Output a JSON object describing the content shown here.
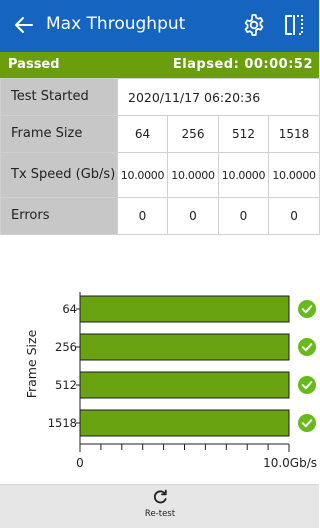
{
  "header": {
    "title": "Max Throughput",
    "back_icon": "arrow-left-icon",
    "settings_icon": "gear-icon",
    "panel_icon": "split-panel-icon",
    "bg_color": "#1565c0"
  },
  "status": {
    "result": "Passed",
    "elapsed": "Elapsed: 00:00:52",
    "bg_color": "#6a9e0c"
  },
  "table": {
    "test_started_label": "Test Started",
    "test_started_value": "2020/11/17 06:20:36",
    "frame_size_label": "Frame Size",
    "frame_sizes": [
      "64",
      "256",
      "512",
      "1518"
    ],
    "tx_speed_label": "Tx Speed (Gb/s)",
    "tx_speeds": [
      "10.0000",
      "10.0000",
      "10.0000",
      "10.0000"
    ],
    "errors_label": "Errors",
    "errors": [
      "0",
      "0",
      "0",
      "0"
    ]
  },
  "chart_data": {
    "type": "bar",
    "orientation": "horizontal",
    "categories": [
      "64",
      "256",
      "512",
      "1518"
    ],
    "values": [
      10.0,
      10.0,
      10.0,
      10.0
    ],
    "xlim": [
      0,
      10.0
    ],
    "xtick_labels": [
      "0",
      "10.0Gb/s"
    ],
    "ylabel": "Frame Size",
    "bar_color": "#6aa312",
    "status_icon": "check-circle-icon",
    "status_color": "#66bb1a"
  },
  "footer": {
    "retest_label": "Re-test",
    "retest_icon": "refresh-icon"
  }
}
